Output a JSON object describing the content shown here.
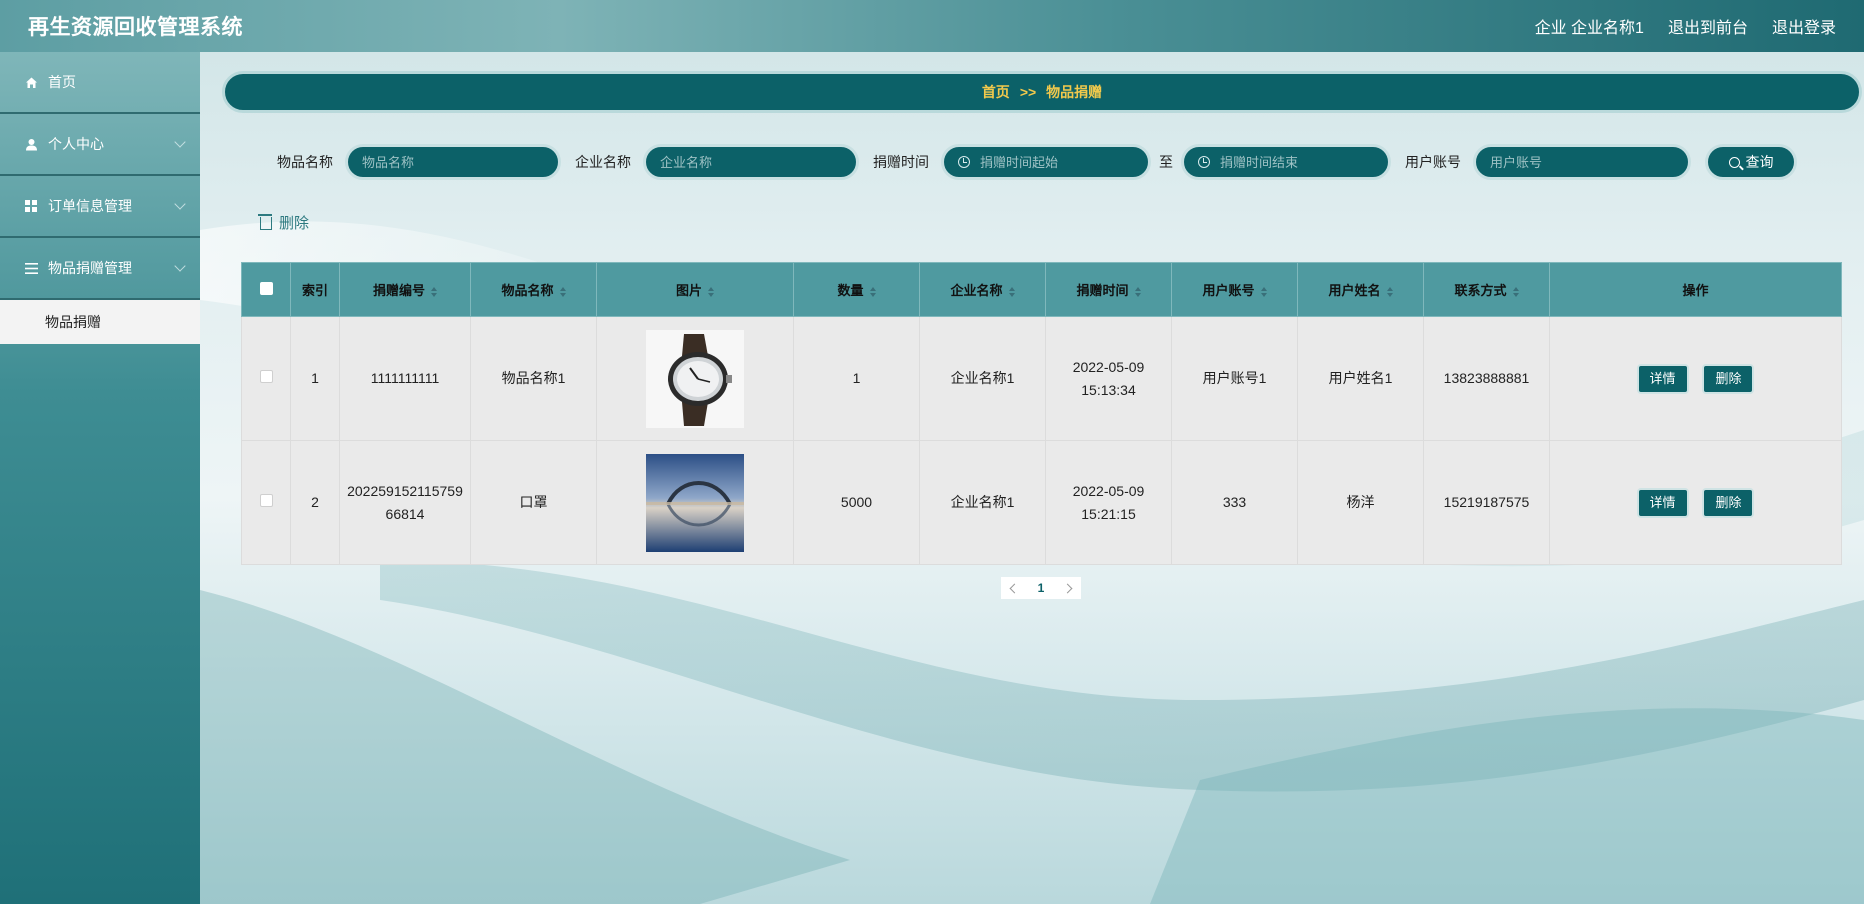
{
  "app": {
    "title": "再生资源回收管理系统"
  },
  "header": {
    "user_label": "企业 企业名称1",
    "to_front": "退出到前台",
    "logout": "退出登录"
  },
  "sidebar": {
    "items": [
      {
        "label": "首页",
        "icon": "home-icon"
      },
      {
        "label": "个人中心",
        "icon": "user-icon"
      },
      {
        "label": "订单信息管理",
        "icon": "grid-icon"
      },
      {
        "label": "物品捐赠管理",
        "icon": "list-icon"
      }
    ],
    "sub_items": [
      {
        "label": "物品捐赠"
      }
    ]
  },
  "breadcrumb": {
    "home": "首页",
    "sep": ">>",
    "current": "物品捐赠"
  },
  "search": {
    "item_name_label": "物品名称",
    "item_name_placeholder": "物品名称",
    "company_label": "企业名称",
    "company_placeholder": "企业名称",
    "time_label": "捐赠时间",
    "time_start_placeholder": "捐赠时间起始",
    "to": "至",
    "time_end_placeholder": "捐赠时间结束",
    "account_label": "用户账号",
    "account_placeholder": "用户账号",
    "query_label": "查询"
  },
  "toolbar": {
    "delete_label": "删除"
  },
  "table": {
    "columns": [
      "索引",
      "捐赠编号",
      "物品名称",
      "图片",
      "数量",
      "企业名称",
      "捐赠时间",
      "用户账号",
      "用户姓名",
      "联系方式",
      "操作"
    ],
    "rows": [
      {
        "index": "1",
        "donation_no": "1111111111",
        "item_name": "物品名称1",
        "image": "watch",
        "quantity": "1",
        "company": "企业名称1",
        "time": "2022-05-09 15:13:34",
        "account": "用户账号1",
        "user_name": "用户姓名1",
        "phone": "13823888881"
      },
      {
        "index": "2",
        "donation_no": "20225915211575966814",
        "item_name": "口罩",
        "image": "bridge",
        "quantity": "5000",
        "company": "企业名称1",
        "time": "2022-05-09 15:21:15",
        "account": "333",
        "user_name": "杨洋",
        "phone": "15219187575"
      }
    ],
    "detail_label": "详情",
    "delete_label": "删除"
  },
  "pager": {
    "current_page": "1"
  },
  "colors": {
    "primary": "#0c6168",
    "accent_text": "#f2c94c",
    "header_bg": "#4f9aa0"
  }
}
